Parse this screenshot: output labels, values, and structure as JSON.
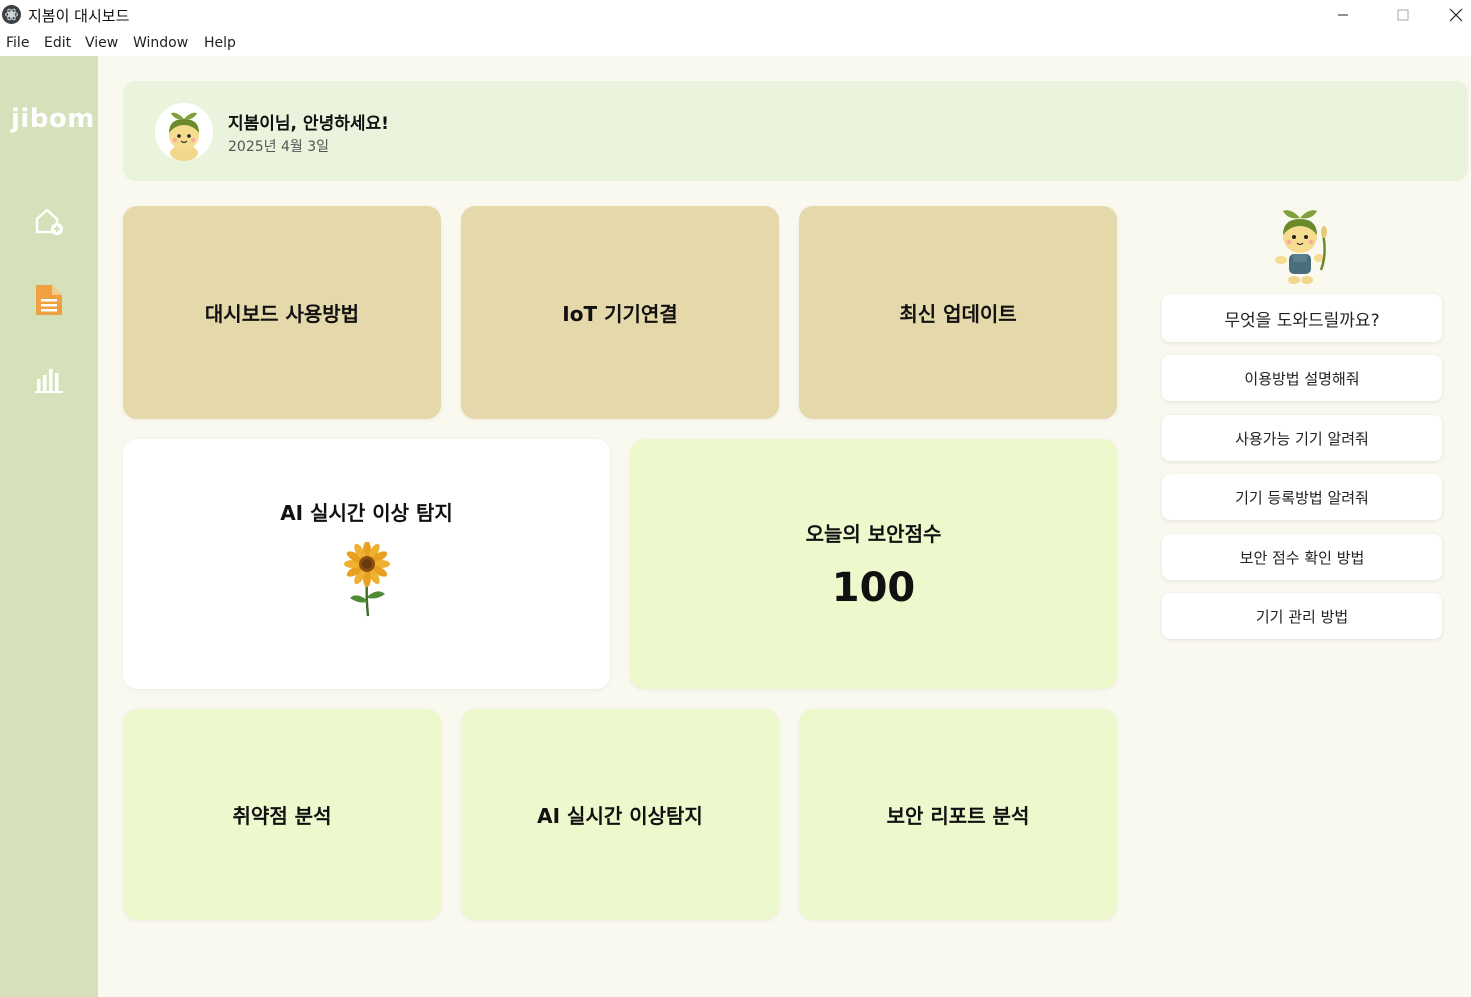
{
  "window": {
    "title": "지봄이 대시보드"
  },
  "menu": [
    "File",
    "Edit",
    "View",
    "Window",
    "Help"
  ],
  "sidebar": {
    "logo": "jibom",
    "items": [
      {
        "icon": "home-add-icon",
        "color": "#ffffff"
      },
      {
        "icon": "document-icon",
        "color": "#f0a040"
      },
      {
        "icon": "bar-chart-icon",
        "color": "#ffffff"
      }
    ]
  },
  "greeting": {
    "title": "지봄이님, 안녕하세요!",
    "date": "2025년 4월 3일"
  },
  "cards": {
    "row1": [
      "대시보드 사용방법",
      "IoT 기기연결",
      "최신 업데이트"
    ],
    "anomaly": "AI 실시간 이상 탐지",
    "score": {
      "label": "오늘의 보안점수",
      "value": "100"
    },
    "row3": [
      "취약점 분석",
      "AI 실시간 이상탐지",
      "보안 리포트 분석"
    ]
  },
  "chat": {
    "question": "무엇을 도와드릴까요?",
    "suggestions": [
      "이용방법 설명해줘",
      "사용가능 기기 알려줘",
      "기기 등록방법 알려줘",
      "보안 점수 확인 방법",
      "기기 관리 방법"
    ]
  },
  "colors": {
    "sidebar": "#d5e1bb",
    "tan_card": "#e5d8aa",
    "lime_card": "#eef8cd",
    "greeting_bg": "#eaf3dc",
    "accent_orange": "#f0a040"
  }
}
